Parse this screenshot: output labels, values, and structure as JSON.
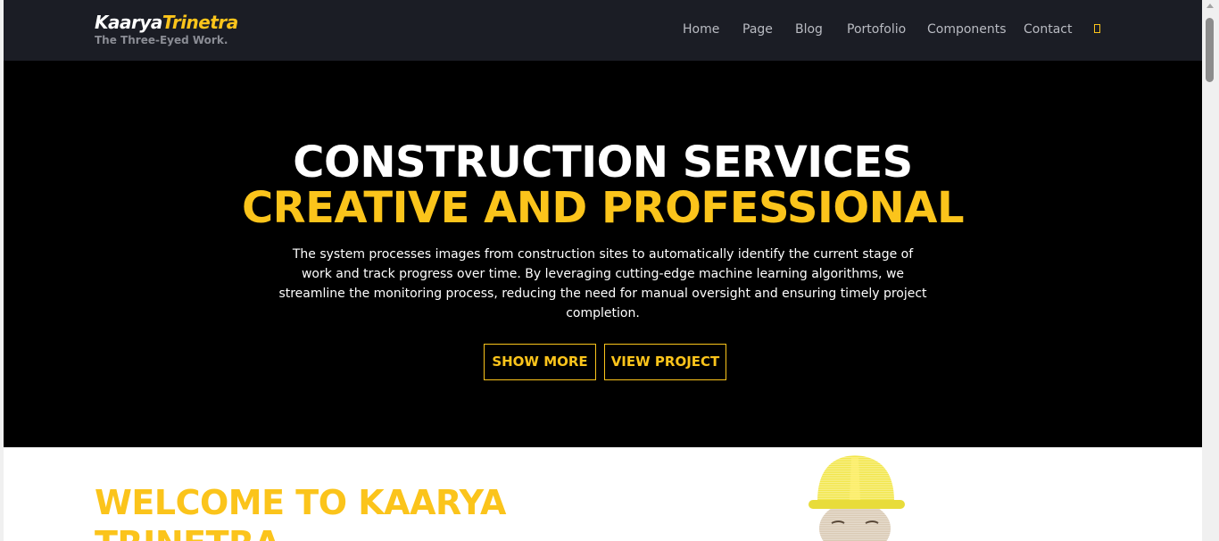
{
  "brand": {
    "name_part1": "Kaarya",
    "name_part2": "Trinetra",
    "tagline": "The Three-Eyed Work."
  },
  "nav": {
    "items": [
      "Home",
      "Page",
      "Blog",
      "Portofolio",
      "Components",
      "Contact"
    ],
    "icon": "search-icon"
  },
  "hero": {
    "title": "CONSTRUCTION SERVICES",
    "subtitle": "CREATIVE AND PROFESSIONAL",
    "description": "The system processes images from construction sites to automatically identify the current stage of work and track progress over time. By leveraging cutting-edge machine learning algorithms, we streamline the monitoring process, reducing the need for manual oversight and ensuring timely project completion.",
    "buttons": {
      "show_more": "SHOW MORE",
      "view_project": "VIEW PROJECT"
    }
  },
  "welcome": {
    "title": "WELCOME TO KAARYA TRINETRA"
  },
  "colors": {
    "accent": "#fbc41b",
    "navbar_bg": "#1b1d25",
    "hero_bg": "#000000",
    "nav_text": "#b9bbc2"
  }
}
